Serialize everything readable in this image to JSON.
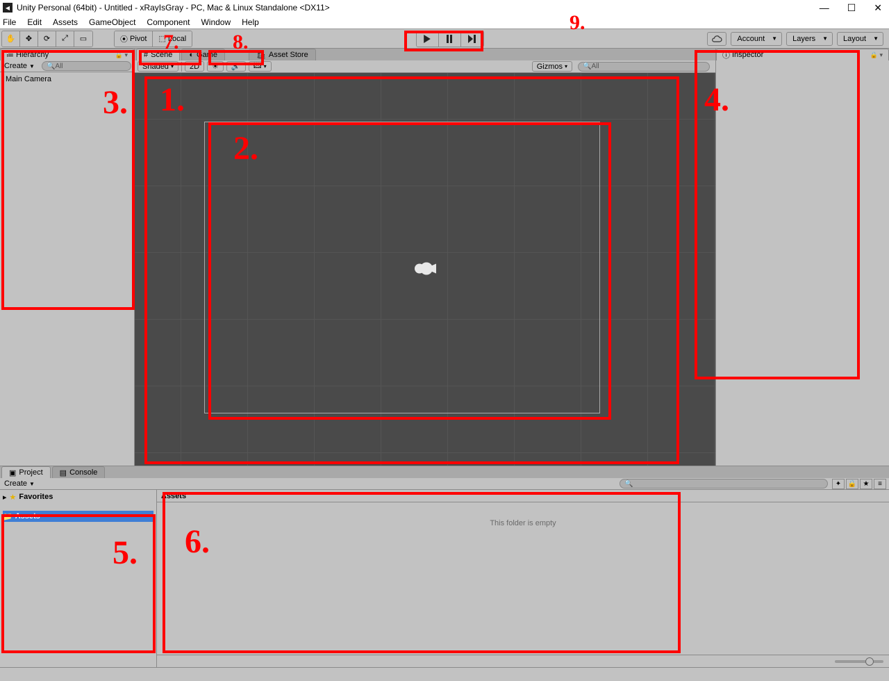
{
  "window": {
    "title": "Unity Personal (64bit) - Untitled - xRayIsGray - PC, Mac & Linux Standalone <DX11>"
  },
  "menu": {
    "file": "File",
    "edit": "Edit",
    "assets": "Assets",
    "gameobject": "GameObject",
    "component": "Component",
    "window": "Window",
    "help": "Help"
  },
  "toolbar": {
    "pivot": "Pivot",
    "local": "Local",
    "account": "Account",
    "layers": "Layers",
    "layout": "Layout"
  },
  "hierarchy": {
    "tab": "Hierarchy",
    "create": "Create",
    "search_placeholder": "All",
    "items": [
      "Main Camera"
    ]
  },
  "center_tabs": {
    "scene": "Scene",
    "game": "Game",
    "asset_store": "Asset Store"
  },
  "scene_sub": {
    "shaded": "Shaded",
    "twod": "2D",
    "gizmos": "Gizmos",
    "search_placeholder": "All"
  },
  "inspector": {
    "tab": "Inspector"
  },
  "project": {
    "tab_project": "Project",
    "tab_console": "Console",
    "create": "Create",
    "favorites": "Favorites",
    "assets": "Assets",
    "assets_header": "Assets",
    "empty": "This folder is empty"
  },
  "annotations": {
    "n1": "1.",
    "n2": "2.",
    "n3": "3.",
    "n4": "4.",
    "n5": "5.",
    "n6": "6.",
    "n7": "7.",
    "n8": "8.",
    "n9": "9."
  }
}
